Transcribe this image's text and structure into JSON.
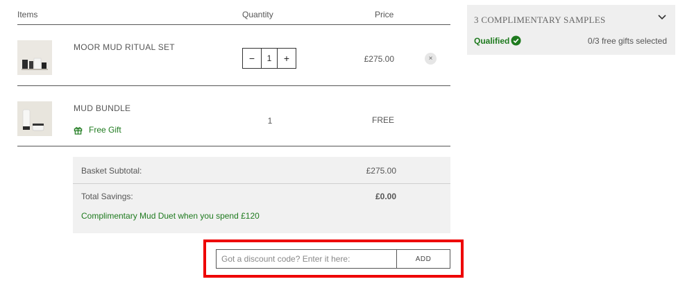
{
  "table": {
    "header_items": "Items",
    "header_quantity": "Quantity",
    "header_price": "Price"
  },
  "line_items": [
    {
      "name": "MOOR MUD RITUAL SET",
      "quantity": "1",
      "price": "£275.00",
      "decrease_symbol": "−",
      "increase_symbol": "+",
      "remove_symbol": "×"
    },
    {
      "name": "MUD BUNDLE",
      "quantity": "1",
      "price": "FREE",
      "gift_label": "Free Gift"
    }
  ],
  "summary": {
    "subtotal_label": "Basket Subtotal:",
    "subtotal_value": "£275.00",
    "savings_label": "Total Savings:",
    "savings_value": "£0.00",
    "promo_message": "Complimentary Mud Duet when you spend £120"
  },
  "discount": {
    "placeholder": "Got a discount code? Enter it here:",
    "value": "",
    "add_label": "ADD"
  },
  "samples_panel": {
    "title": "3 COMPLIMENTARY SAMPLES",
    "status": "Qualified",
    "gifts_selected": "0/3 free gifts selected"
  },
  "colors": {
    "accent_green": "#1e7a1e",
    "highlight_red": "#ee0000",
    "panel_gray": "#efefef"
  },
  "icons": [
    "gift-icon",
    "check-circle-icon",
    "chevron-down-icon",
    "close-icon"
  ]
}
